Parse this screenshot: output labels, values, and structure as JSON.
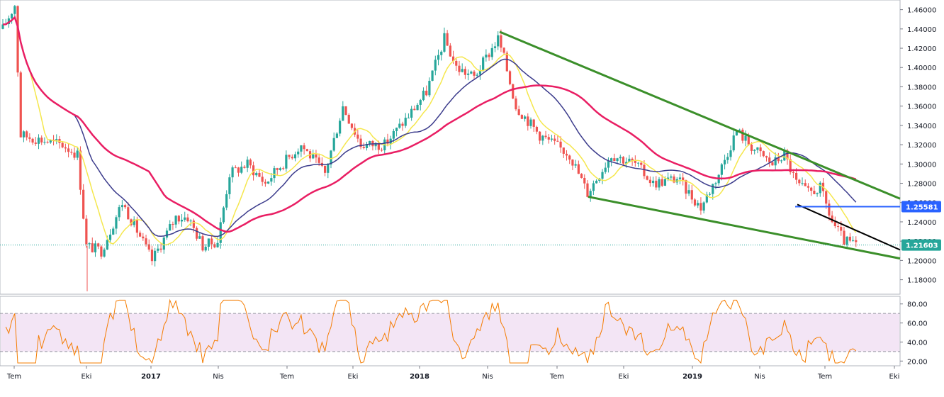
{
  "chart_data": [
    {
      "type": "candlestick",
      "y_axis": {
        "ticks": [
          "1.46000",
          "1.44000",
          "1.42000",
          "1.40000",
          "1.38000",
          "1.36000",
          "1.34000",
          "1.32000",
          "1.30000",
          "1.28000",
          "1.26000",
          "1.24000",
          "1.22000",
          "1.20000",
          "1.18000"
        ],
        "ylim": [
          1.165,
          1.47
        ]
      },
      "x_axis": {
        "ticks": [
          "Tem",
          "Eki",
          "2017",
          "Nis",
          "Tem",
          "Eki",
          "2018",
          "Nis",
          "Tem",
          "Eki",
          "2019",
          "Nis",
          "Tem",
          "Eki"
        ]
      },
      "price_labels": [
        {
          "value": "1.25581",
          "color": "#2962ff"
        },
        {
          "value": "1.21603",
          "color": "#26a69a"
        }
      ],
      "current_price": 1.21603,
      "horizontal_level": 1.25581,
      "colors": {
        "up": "#26a69a",
        "down": "#ef5350",
        "ma_fast": "#f5e74d",
        "ma_mid": "#3c3c8c",
        "ma_slow": "#e91e63",
        "trend_green": "#3b8f2a",
        "trend_black": "#000000",
        "level_blue": "#2962ff"
      },
      "grid": false
    },
    {
      "type": "line",
      "indicator": "oscillator",
      "y_axis": {
        "ticks": [
          "80.00",
          "60.00",
          "40.00",
          "20.00"
        ],
        "ylim": [
          15,
          88
        ]
      },
      "band": [
        30,
        70
      ],
      "colors": {
        "line": "#f57c00",
        "band": "#f3e5f5"
      }
    }
  ]
}
